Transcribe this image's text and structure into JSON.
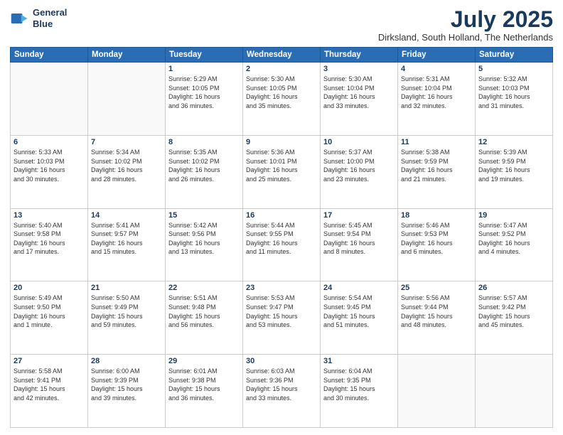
{
  "logo": {
    "line1": "General",
    "line2": "Blue"
  },
  "title": "July 2025",
  "subtitle": "Dirksland, South Holland, The Netherlands",
  "weekdays": [
    "Sunday",
    "Monday",
    "Tuesday",
    "Wednesday",
    "Thursday",
    "Friday",
    "Saturday"
  ],
  "weeks": [
    [
      {
        "day": "",
        "info": ""
      },
      {
        "day": "",
        "info": ""
      },
      {
        "day": "1",
        "info": "Sunrise: 5:29 AM\nSunset: 10:05 PM\nDaylight: 16 hours\nand 36 minutes."
      },
      {
        "day": "2",
        "info": "Sunrise: 5:30 AM\nSunset: 10:05 PM\nDaylight: 16 hours\nand 35 minutes."
      },
      {
        "day": "3",
        "info": "Sunrise: 5:30 AM\nSunset: 10:04 PM\nDaylight: 16 hours\nand 33 minutes."
      },
      {
        "day": "4",
        "info": "Sunrise: 5:31 AM\nSunset: 10:04 PM\nDaylight: 16 hours\nand 32 minutes."
      },
      {
        "day": "5",
        "info": "Sunrise: 5:32 AM\nSunset: 10:03 PM\nDaylight: 16 hours\nand 31 minutes."
      }
    ],
    [
      {
        "day": "6",
        "info": "Sunrise: 5:33 AM\nSunset: 10:03 PM\nDaylight: 16 hours\nand 30 minutes."
      },
      {
        "day": "7",
        "info": "Sunrise: 5:34 AM\nSunset: 10:02 PM\nDaylight: 16 hours\nand 28 minutes."
      },
      {
        "day": "8",
        "info": "Sunrise: 5:35 AM\nSunset: 10:02 PM\nDaylight: 16 hours\nand 26 minutes."
      },
      {
        "day": "9",
        "info": "Sunrise: 5:36 AM\nSunset: 10:01 PM\nDaylight: 16 hours\nand 25 minutes."
      },
      {
        "day": "10",
        "info": "Sunrise: 5:37 AM\nSunset: 10:00 PM\nDaylight: 16 hours\nand 23 minutes."
      },
      {
        "day": "11",
        "info": "Sunrise: 5:38 AM\nSunset: 9:59 PM\nDaylight: 16 hours\nand 21 minutes."
      },
      {
        "day": "12",
        "info": "Sunrise: 5:39 AM\nSunset: 9:59 PM\nDaylight: 16 hours\nand 19 minutes."
      }
    ],
    [
      {
        "day": "13",
        "info": "Sunrise: 5:40 AM\nSunset: 9:58 PM\nDaylight: 16 hours\nand 17 minutes."
      },
      {
        "day": "14",
        "info": "Sunrise: 5:41 AM\nSunset: 9:57 PM\nDaylight: 16 hours\nand 15 minutes."
      },
      {
        "day": "15",
        "info": "Sunrise: 5:42 AM\nSunset: 9:56 PM\nDaylight: 16 hours\nand 13 minutes."
      },
      {
        "day": "16",
        "info": "Sunrise: 5:44 AM\nSunset: 9:55 PM\nDaylight: 16 hours\nand 11 minutes."
      },
      {
        "day": "17",
        "info": "Sunrise: 5:45 AM\nSunset: 9:54 PM\nDaylight: 16 hours\nand 8 minutes."
      },
      {
        "day": "18",
        "info": "Sunrise: 5:46 AM\nSunset: 9:53 PM\nDaylight: 16 hours\nand 6 minutes."
      },
      {
        "day": "19",
        "info": "Sunrise: 5:47 AM\nSunset: 9:52 PM\nDaylight: 16 hours\nand 4 minutes."
      }
    ],
    [
      {
        "day": "20",
        "info": "Sunrise: 5:49 AM\nSunset: 9:50 PM\nDaylight: 16 hours\nand 1 minute."
      },
      {
        "day": "21",
        "info": "Sunrise: 5:50 AM\nSunset: 9:49 PM\nDaylight: 15 hours\nand 59 minutes."
      },
      {
        "day": "22",
        "info": "Sunrise: 5:51 AM\nSunset: 9:48 PM\nDaylight: 15 hours\nand 56 minutes."
      },
      {
        "day": "23",
        "info": "Sunrise: 5:53 AM\nSunset: 9:47 PM\nDaylight: 15 hours\nand 53 minutes."
      },
      {
        "day": "24",
        "info": "Sunrise: 5:54 AM\nSunset: 9:45 PM\nDaylight: 15 hours\nand 51 minutes."
      },
      {
        "day": "25",
        "info": "Sunrise: 5:56 AM\nSunset: 9:44 PM\nDaylight: 15 hours\nand 48 minutes."
      },
      {
        "day": "26",
        "info": "Sunrise: 5:57 AM\nSunset: 9:42 PM\nDaylight: 15 hours\nand 45 minutes."
      }
    ],
    [
      {
        "day": "27",
        "info": "Sunrise: 5:58 AM\nSunset: 9:41 PM\nDaylight: 15 hours\nand 42 minutes."
      },
      {
        "day": "28",
        "info": "Sunrise: 6:00 AM\nSunset: 9:39 PM\nDaylight: 15 hours\nand 39 minutes."
      },
      {
        "day": "29",
        "info": "Sunrise: 6:01 AM\nSunset: 9:38 PM\nDaylight: 15 hours\nand 36 minutes."
      },
      {
        "day": "30",
        "info": "Sunrise: 6:03 AM\nSunset: 9:36 PM\nDaylight: 15 hours\nand 33 minutes."
      },
      {
        "day": "31",
        "info": "Sunrise: 6:04 AM\nSunset: 9:35 PM\nDaylight: 15 hours\nand 30 minutes."
      },
      {
        "day": "",
        "info": ""
      },
      {
        "day": "",
        "info": ""
      }
    ]
  ]
}
